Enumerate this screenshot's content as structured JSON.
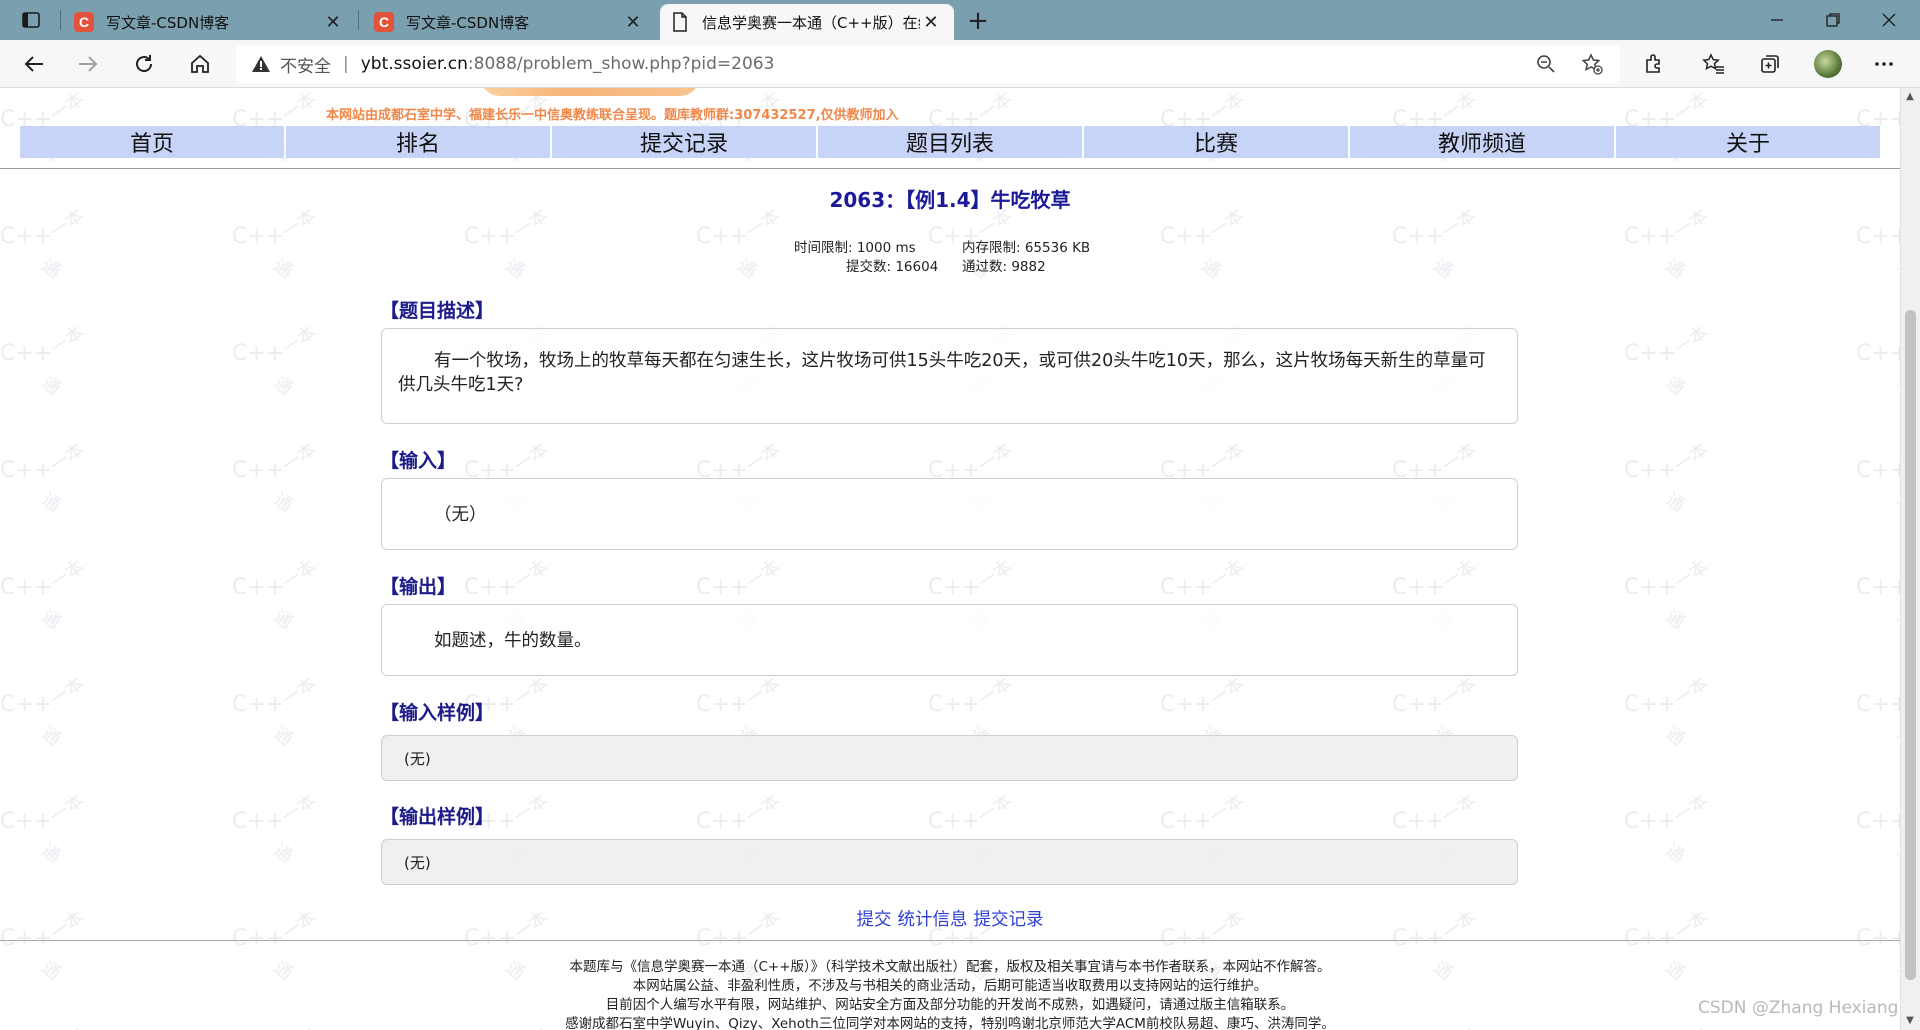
{
  "browser": {
    "tabs": [
      {
        "title": "写文章-CSDN博客",
        "favicon": "csdn-icon",
        "active": false
      },
      {
        "title": "写文章-CSDN博客",
        "favicon": "csdn-icon",
        "active": false
      },
      {
        "title": "信息学奥赛一本通（C++版）在线",
        "favicon": "document-icon",
        "active": true
      }
    ],
    "address": {
      "security_label": "不安全",
      "host": "ybt.ssoier.cn",
      "path": ":8088/problem_show.php?pid=2063"
    },
    "icons": {
      "tab_actions": "tab-actions-icon",
      "new_tab": "plus-icon",
      "back": "back-arrow-icon",
      "forward": "forward-arrow-icon",
      "refresh": "refresh-icon",
      "home": "home-icon",
      "warning": "warning-icon",
      "zoom": "zoom-icon",
      "favorite_add": "add-favorite-icon",
      "extensions": "extensions-icon",
      "favorites": "favorites-icon",
      "collections": "collections-icon",
      "profile": "profile-avatar",
      "more": "more-icon"
    }
  },
  "site": {
    "announcement": "本网站由成都石室中学、福建长乐一中信奥教练联合呈现。题库教师群:307432527,仅供教师加入",
    "menu": [
      "首页",
      "排名",
      "提交记录",
      "题目列表",
      "比赛",
      "教师频道",
      "关于"
    ]
  },
  "problem": {
    "title": "2063：【例1.4】牛吃牧草",
    "time_limit": "时间限制: 1000 ms",
    "memory_limit": "内存限制: 65536 KB",
    "submissions": "提交数: 16604",
    "accepted": "通过数: 9882",
    "sections": {
      "description_head": "【题目描述】",
      "description": "有一个牧场，牧场上的牧草每天都在匀速生长，这片牧场可供15头牛吃20天，或可供20头牛吃10天，那么，这片牧场每天新生的草量可供几头牛吃1天?",
      "input_head": "【输入】",
      "input": "（无）",
      "output_head": "【输出】",
      "output": "如题述，牛的数量。",
      "sample_input_head": "【输入样例】",
      "sample_input": "(无)",
      "sample_output_head": "【输出样例】",
      "sample_output": "(无)"
    },
    "links": {
      "submit": "提交",
      "stats": "统计信息",
      "records": "提交记录"
    }
  },
  "footer": {
    "lines": [
      "本题库与《信息学奥赛一本通（C++版）》（科学技术文献出版社）配套，版权及相关事宜请与本书作者联系，本网站不作解答。",
      "本网站属公益、非盈利性质，不涉及与书相关的商业活动，后期可能适当收取费用以支持网站的运行维护。",
      "目前因个人编写水平有限，网站维护、网站安全方面及部分功能的开发尚不成熟，如遇疑问，请通过版主信箱联系。",
      "感谢成都石室中学Wuyin、Qizy、Xehoth三位同学对本网站的支持，特别鸣谢北京师范大学ACM前校队易超、康巧、洪涛同学。"
    ],
    "csdn_watermark": "CSDN @Zhang Hexiang"
  },
  "colors": {
    "tabstrip": "#7a9fae",
    "menu_bg": "#c7d3f7",
    "title_blue": "#1b1b9a",
    "link_blue": "#2e3fd6",
    "announce_orange": "#f0884a"
  }
}
